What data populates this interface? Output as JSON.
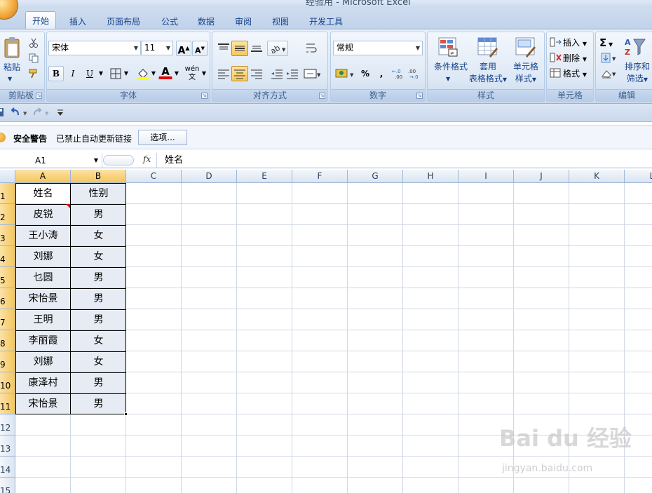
{
  "app": {
    "title": "经验用 - Microsoft Excel"
  },
  "tabs": [
    "开始",
    "插入",
    "页面布局",
    "公式",
    "数据",
    "审阅",
    "视图",
    "开发工具"
  ],
  "ribbon": {
    "clipboard": {
      "paste_label": "粘贴",
      "group_label": "剪贴板"
    },
    "font": {
      "font_name": "宋体",
      "font_size": "11",
      "bold": "B",
      "italic": "I",
      "underline": "U",
      "grow": "A",
      "shrink": "A",
      "font_color": "A",
      "phonetic": "wén",
      "group_label": "字体"
    },
    "alignment": {
      "group_label": "对齐方式"
    },
    "number": {
      "format": "常规",
      "percent": "%",
      "comma": ",",
      "increase_decimal": "←.0 .00",
      "decrease_decimal": ".00 →.0",
      "group_label": "数字"
    },
    "styles": {
      "conditional": "条件格式",
      "table_line1": "套用",
      "table_line2": "表格格式",
      "cell_line1": "单元格",
      "cell_line2": "样式",
      "group_label": "样式"
    },
    "cells": {
      "insert": "插入",
      "delete": "删除",
      "format": "格式",
      "group_label": "单元格"
    },
    "editing": {
      "sum": "Σ",
      "sort_line1": "排序和",
      "sort_line2": "筛选",
      "group_label": "编辑"
    }
  },
  "security": {
    "title": "安全警告",
    "message": "已禁止自动更新链接",
    "options_button": "选项..."
  },
  "formula_bar": {
    "name_box": "A1",
    "fx": "fx",
    "content": "姓名"
  },
  "columns": [
    "A",
    "B",
    "C",
    "D",
    "E",
    "F",
    "G",
    "H",
    "I",
    "J",
    "K",
    "L"
  ],
  "rows": [
    "1",
    "2",
    "3",
    "4",
    "5",
    "6",
    "7",
    "8",
    "9",
    "10",
    "11",
    "12",
    "13",
    "14",
    "15"
  ],
  "table": [
    [
      "姓名",
      "性别"
    ],
    [
      "皮锐",
      "男"
    ],
    [
      "王小涛",
      "女"
    ],
    [
      "刘娜",
      "女"
    ],
    [
      "乜圆",
      "男"
    ],
    [
      "宋怡景",
      "男"
    ],
    [
      "王明",
      "男"
    ],
    [
      "李丽霞",
      "女"
    ],
    [
      "刘娜",
      "女"
    ],
    [
      "康泽村",
      "男"
    ],
    [
      "宋怡景",
      "男"
    ]
  ],
  "watermark": {
    "main": "Bai du 经验",
    "sub": "jingyan.baidu.com"
  }
}
